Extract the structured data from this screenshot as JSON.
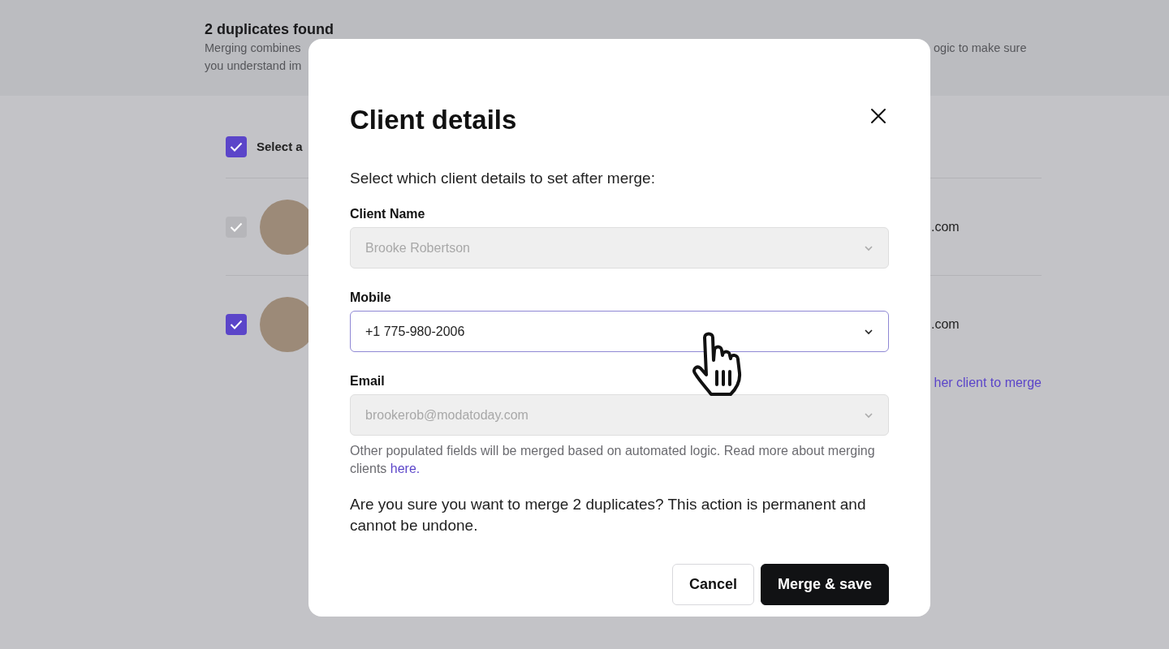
{
  "background": {
    "title": "2 duplicates found",
    "description_left": [
      "Merging combines",
      "you understand im"
    ],
    "description_right": "ogic to make sure",
    "select_all": {
      "label": "Select a",
      "checked": true
    },
    "clients": [
      {
        "email": ".com",
        "checked": true,
        "disabled": true
      },
      {
        "email": ".com",
        "checked": true,
        "disabled": false
      }
    ],
    "add_link": "her client to merge"
  },
  "modal": {
    "title": "Client details",
    "subtitle": "Select which client details to set after merge:",
    "fields": [
      {
        "label": "Client Name",
        "value": "Brooke Robertson",
        "disabled": true
      },
      {
        "label": "Mobile",
        "value": "+1 775-980-2006",
        "disabled": false
      },
      {
        "label": "Email",
        "value": "brookerob@modatoday.com",
        "disabled": true
      }
    ],
    "helper": "Other populated fields will be merged based on automated logic. Read more about merging clients",
    "helper_link": "here.",
    "confirmation": "Are you sure you want to merge 2 duplicates? This action is permanent and cannot be undone.",
    "buttons": [
      {
        "label": "Cancel",
        "kind": "secondary"
      },
      {
        "label": "Merge & save",
        "kind": "primary"
      }
    ]
  }
}
